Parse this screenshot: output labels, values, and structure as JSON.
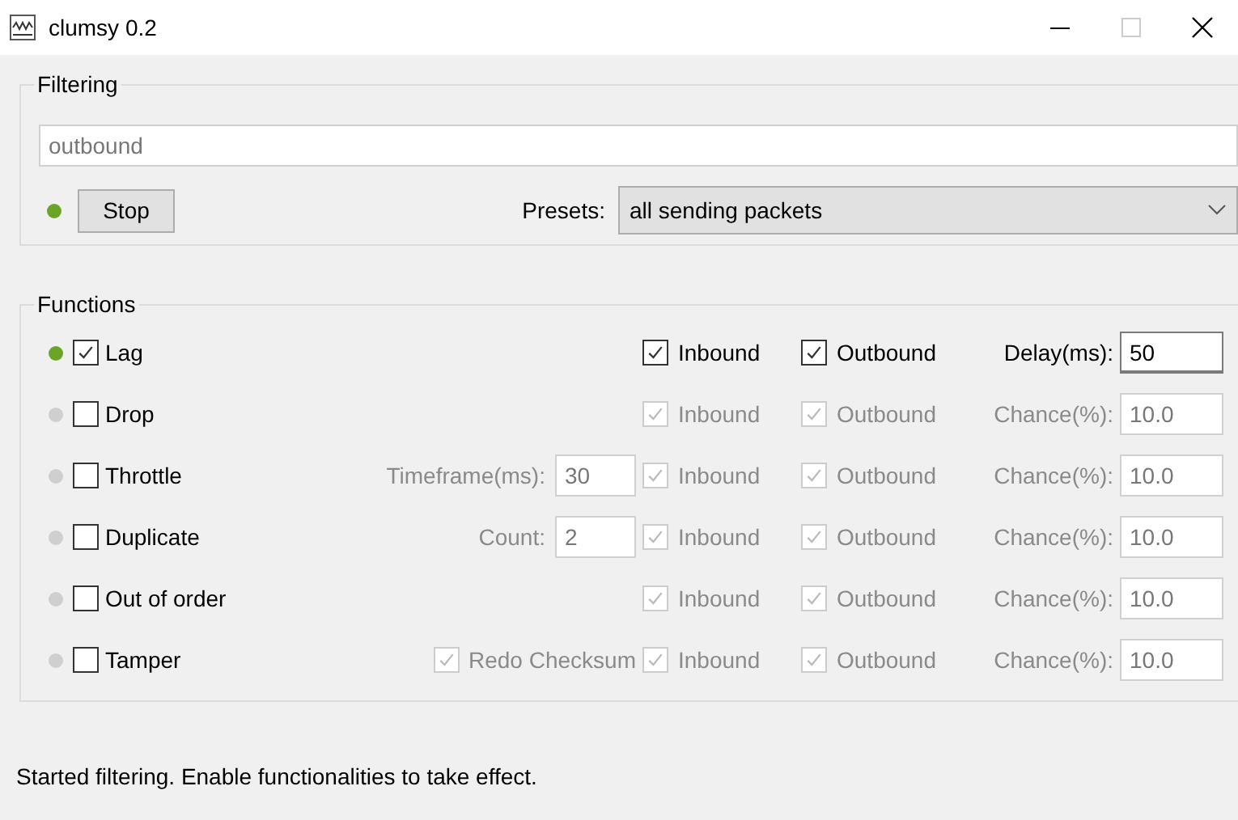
{
  "window": {
    "title": "clumsy 0.2"
  },
  "filtering": {
    "title": "Filtering",
    "filter": {
      "value": "outbound",
      "disabled": true
    },
    "running": true,
    "button": "Stop",
    "presets_label": "Presets:",
    "preset": "all sending packets"
  },
  "functions": {
    "title": "Functions",
    "rows": [
      {
        "name": "Lag",
        "active": true,
        "checked": true,
        "disabled": false,
        "extra": null,
        "inbound": {
          "label": "Inbound",
          "checked": true
        },
        "outbound": {
          "label": "Outbound",
          "checked": true
        },
        "param": {
          "label": "Delay(ms):",
          "value": "50"
        }
      },
      {
        "name": "Drop",
        "active": false,
        "checked": false,
        "disabled": true,
        "extra": null,
        "inbound": {
          "label": "Inbound",
          "checked": true
        },
        "outbound": {
          "label": "Outbound",
          "checked": true
        },
        "param": {
          "label": "Chance(%):",
          "value": "10.0"
        }
      },
      {
        "name": "Throttle",
        "active": false,
        "checked": false,
        "disabled": true,
        "extra": {
          "kind": "field",
          "label": "Timeframe(ms):",
          "value": "30"
        },
        "inbound": {
          "label": "Inbound",
          "checked": true
        },
        "outbound": {
          "label": "Outbound",
          "checked": true
        },
        "param": {
          "label": "Chance(%):",
          "value": "10.0"
        }
      },
      {
        "name": "Duplicate",
        "active": false,
        "checked": false,
        "disabled": true,
        "extra": {
          "kind": "field",
          "label": "Count:",
          "value": "2"
        },
        "inbound": {
          "label": "Inbound",
          "checked": true
        },
        "outbound": {
          "label": "Outbound",
          "checked": true
        },
        "param": {
          "label": "Chance(%):",
          "value": "10.0"
        }
      },
      {
        "name": "Out of order",
        "active": false,
        "checked": false,
        "disabled": true,
        "extra": null,
        "inbound": {
          "label": "Inbound",
          "checked": true
        },
        "outbound": {
          "label": "Outbound",
          "checked": true
        },
        "param": {
          "label": "Chance(%):",
          "value": "10.0"
        }
      },
      {
        "name": "Tamper",
        "active": false,
        "checked": false,
        "disabled": true,
        "extra": {
          "kind": "checkbox",
          "label": "Redo Checksum",
          "checked": true
        },
        "inbound": {
          "label": "Inbound",
          "checked": true
        },
        "outbound": {
          "label": "Outbound",
          "checked": true
        },
        "param": {
          "label": "Chance(%):",
          "value": "10.0"
        }
      }
    ]
  },
  "status_bar": "Started filtering. Enable functionalities to take effect."
}
